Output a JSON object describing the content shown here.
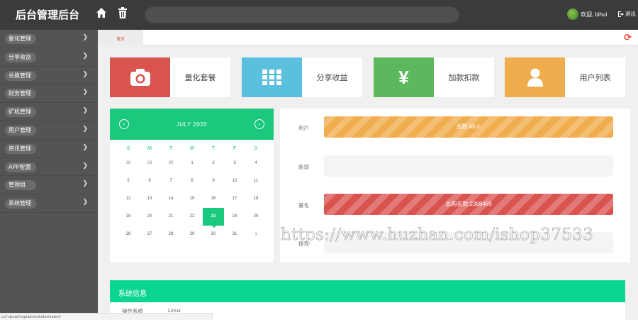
{
  "header": {
    "title": "后台管理后台",
    "home_icon": "home-icon",
    "trash_icon": "trash-icon",
    "search_placeholder": "",
    "user_greeting": "欢迎, bihui",
    "logout_label": "退出"
  },
  "sidebar": {
    "items": [
      {
        "label": "量化管理"
      },
      {
        "label": "分享收益"
      },
      {
        "label": "兑换管理"
      },
      {
        "label": "财务管理"
      },
      {
        "label": "矿机管理"
      },
      {
        "label": "用户管理"
      },
      {
        "label": "资讯管理"
      },
      {
        "label": "APP配置"
      },
      {
        "label": "管理组"
      },
      {
        "label": "系统管理"
      }
    ]
  },
  "tabs": {
    "active": "首页"
  },
  "cards": [
    {
      "label": "量化套餐",
      "icon": "camera-icon",
      "color": "#d9534f"
    },
    {
      "label": "分享收益",
      "icon": "grid-icon",
      "color": "#5bc0de"
    },
    {
      "label": "加款扣款",
      "icon": "yen-icon",
      "color": "#5cb85c"
    },
    {
      "label": "用户列表",
      "icon": "user-icon",
      "color": "#f0ad4e"
    }
  ],
  "calendar": {
    "month": "JULY 2020",
    "weekdays": [
      "S",
      "M",
      "T",
      "W",
      "T",
      "F",
      "S"
    ],
    "days": [
      "28",
      "29",
      "30",
      "1",
      "2",
      "3",
      "4",
      "5",
      "6",
      "7",
      "8",
      "9",
      "10",
      "11",
      "12",
      "13",
      "14",
      "15",
      "16",
      "17",
      "18",
      "19",
      "20",
      "21",
      "22",
      "23",
      "24",
      "25",
      "26",
      "27",
      "28",
      "29",
      "30",
      "31",
      "1"
    ],
    "today": "23"
  },
  "stats": {
    "rows": [
      {
        "label": "用户",
        "text": "总数:40人",
        "value": 1.0,
        "style": "orange"
      },
      {
        "label": "新增",
        "text": "",
        "value": 0,
        "style": "none"
      },
      {
        "label": "量化",
        "text": "总购买数:2388489",
        "value": 1.0,
        "style": "red"
      },
      {
        "label": "提现",
        "text": "",
        "value": 0,
        "style": "none"
      }
    ]
  },
  "watermark": "https://www.huzhan.com/ishop37533",
  "system_info": {
    "title": "系统信息",
    "rows": [
      {
        "key": "操作系统",
        "value": "Linux"
      }
    ]
  },
  "status_url": "cs7.dyxw0.top/admin/index/index#"
}
